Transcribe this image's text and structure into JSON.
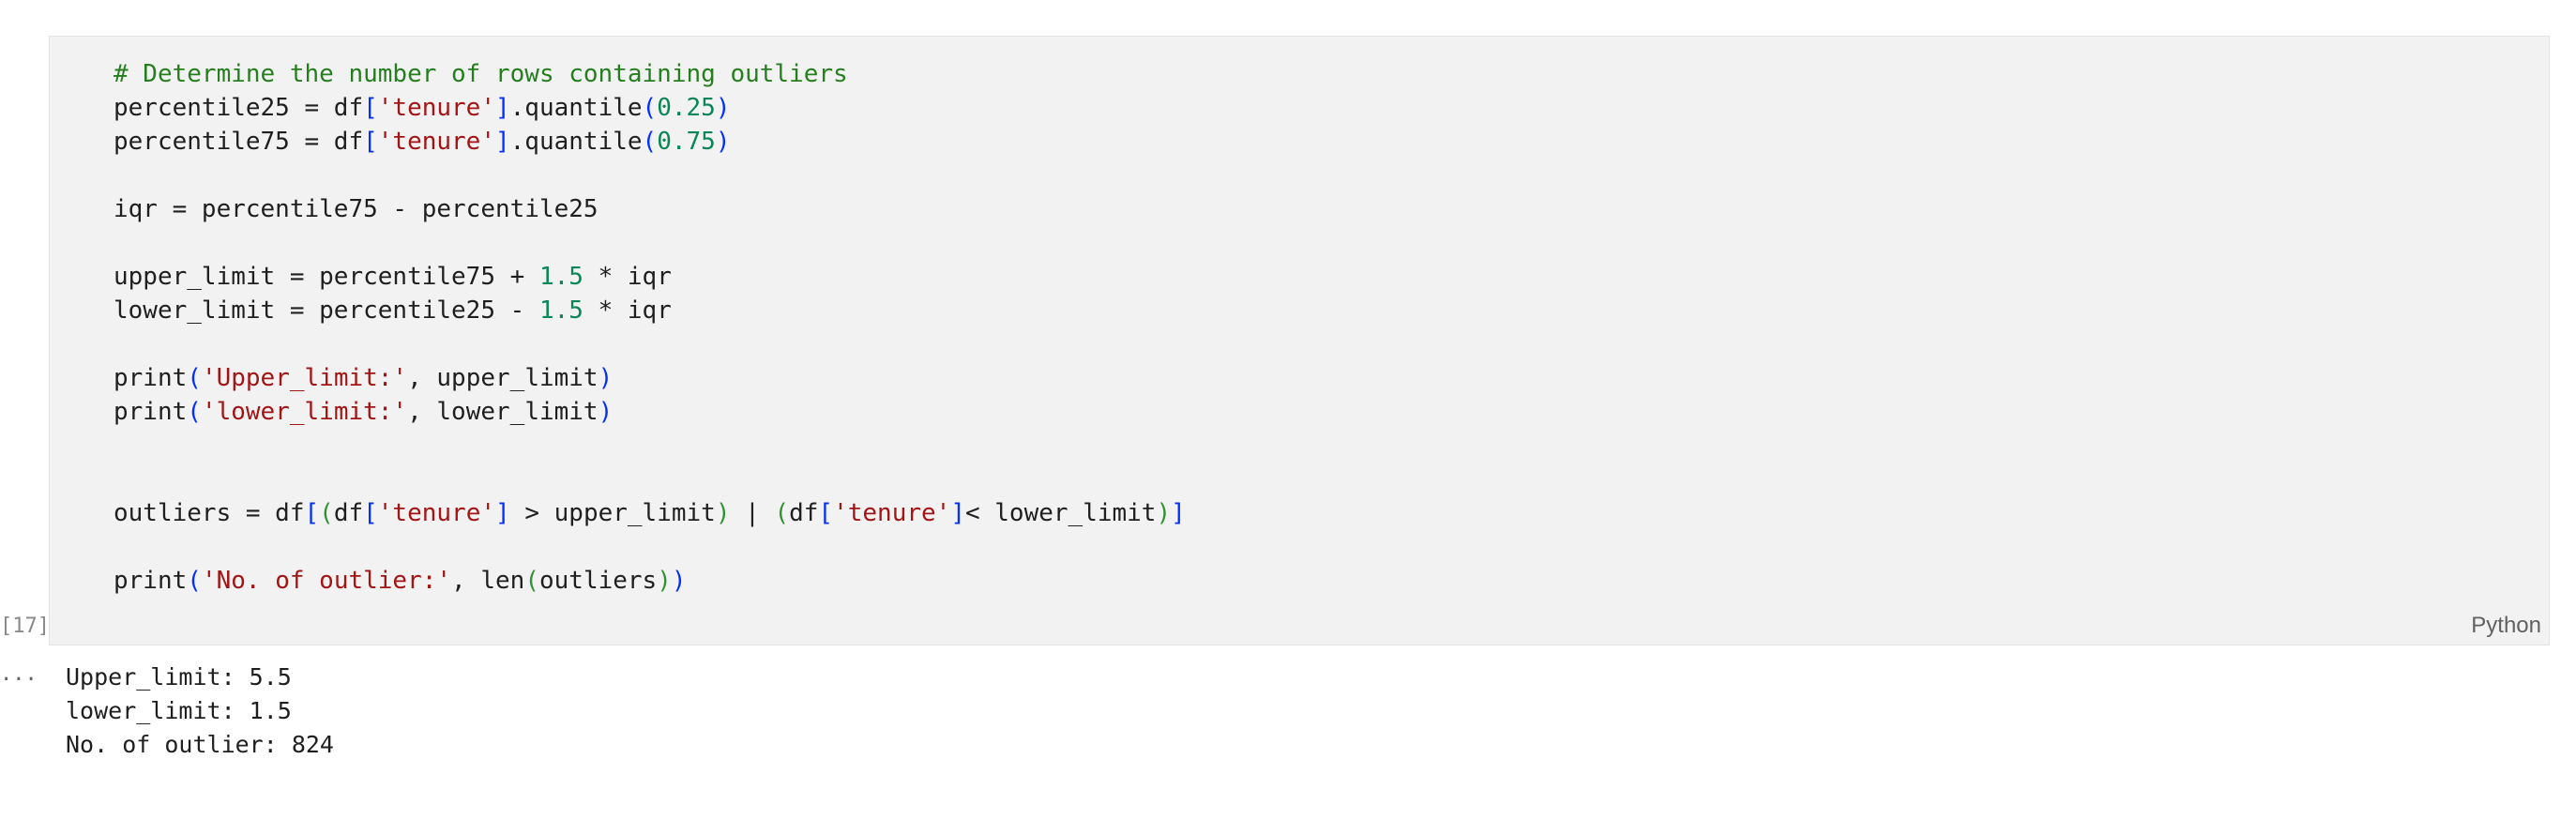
{
  "cell": {
    "execution_count": "[17]",
    "language": "Python",
    "code_lines": [
      [
        {
          "t": "# Determine the number of rows containing outliers",
          "c": "comment"
        }
      ],
      [
        {
          "t": "percentile25 = df",
          "c": "default"
        },
        {
          "t": "[",
          "c": "b1"
        },
        {
          "t": "'tenure'",
          "c": "string"
        },
        {
          "t": "]",
          "c": "b1"
        },
        {
          "t": ".quantile",
          "c": "default"
        },
        {
          "t": "(",
          "c": "b1"
        },
        {
          "t": "0.25",
          "c": "number"
        },
        {
          "t": ")",
          "c": "b1"
        }
      ],
      [
        {
          "t": "percentile75 = df",
          "c": "default"
        },
        {
          "t": "[",
          "c": "b1"
        },
        {
          "t": "'tenure'",
          "c": "string"
        },
        {
          "t": "]",
          "c": "b1"
        },
        {
          "t": ".quantile",
          "c": "default"
        },
        {
          "t": "(",
          "c": "b1"
        },
        {
          "t": "0.75",
          "c": "number"
        },
        {
          "t": ")",
          "c": "b1"
        }
      ],
      [],
      [
        {
          "t": "iqr = percentile75 - percentile25",
          "c": "default"
        }
      ],
      [],
      [
        {
          "t": "upper_limit = percentile75 + ",
          "c": "default"
        },
        {
          "t": "1.5",
          "c": "number"
        },
        {
          "t": " * iqr",
          "c": "default"
        }
      ],
      [
        {
          "t": "lower_limit = percentile25 - ",
          "c": "default"
        },
        {
          "t": "1.5",
          "c": "number"
        },
        {
          "t": " * iqr",
          "c": "default"
        }
      ],
      [],
      [
        {
          "t": "print",
          "c": "default"
        },
        {
          "t": "(",
          "c": "b1"
        },
        {
          "t": "'Upper_limit:'",
          "c": "string"
        },
        {
          "t": ", upper_limit",
          "c": "default"
        },
        {
          "t": ")",
          "c": "b1"
        }
      ],
      [
        {
          "t": "print",
          "c": "default"
        },
        {
          "t": "(",
          "c": "b1"
        },
        {
          "t": "'lower_limit:'",
          "c": "string"
        },
        {
          "t": ", lower_limit",
          "c": "default"
        },
        {
          "t": ")",
          "c": "b1"
        }
      ],
      [],
      [],
      [
        {
          "t": "outliers = df",
          "c": "default"
        },
        {
          "t": "[",
          "c": "b1"
        },
        {
          "t": "(",
          "c": "b2"
        },
        {
          "t": "df",
          "c": "default"
        },
        {
          "t": "[",
          "c": "b1"
        },
        {
          "t": "'tenure'",
          "c": "string"
        },
        {
          "t": "]",
          "c": "b1"
        },
        {
          "t": " > upper_limit",
          "c": "default"
        },
        {
          "t": ")",
          "c": "b2"
        },
        {
          "t": " | ",
          "c": "default"
        },
        {
          "t": "(",
          "c": "b2"
        },
        {
          "t": "df",
          "c": "default"
        },
        {
          "t": "[",
          "c": "b1"
        },
        {
          "t": "'tenure'",
          "c": "string"
        },
        {
          "t": "]",
          "c": "b1"
        },
        {
          "t": "< lower_limit",
          "c": "default"
        },
        {
          "t": ")",
          "c": "b2"
        },
        {
          "t": "]",
          "c": "b1"
        }
      ],
      [],
      [
        {
          "t": "print",
          "c": "default"
        },
        {
          "t": "(",
          "c": "b1"
        },
        {
          "t": "'No. of outlier:'",
          "c": "string"
        },
        {
          "t": ", len",
          "c": "default"
        },
        {
          "t": "(",
          "c": "b2"
        },
        {
          "t": "outliers",
          "c": "default"
        },
        {
          "t": ")",
          "c": "b2"
        },
        {
          "t": ")",
          "c": "b1"
        }
      ]
    ]
  },
  "output": {
    "ellipsis": "...",
    "lines": [
      "Upper_limit: 5.5",
      "lower_limit: 1.5",
      "No. of outlier: 824"
    ]
  },
  "colors": {
    "comment": "#267f1e",
    "string": "#a31515",
    "number": "#098658",
    "bracket_level1": "#0431fa",
    "bracket_level2": "#319331",
    "cell_background": "#f2f2f2"
  }
}
